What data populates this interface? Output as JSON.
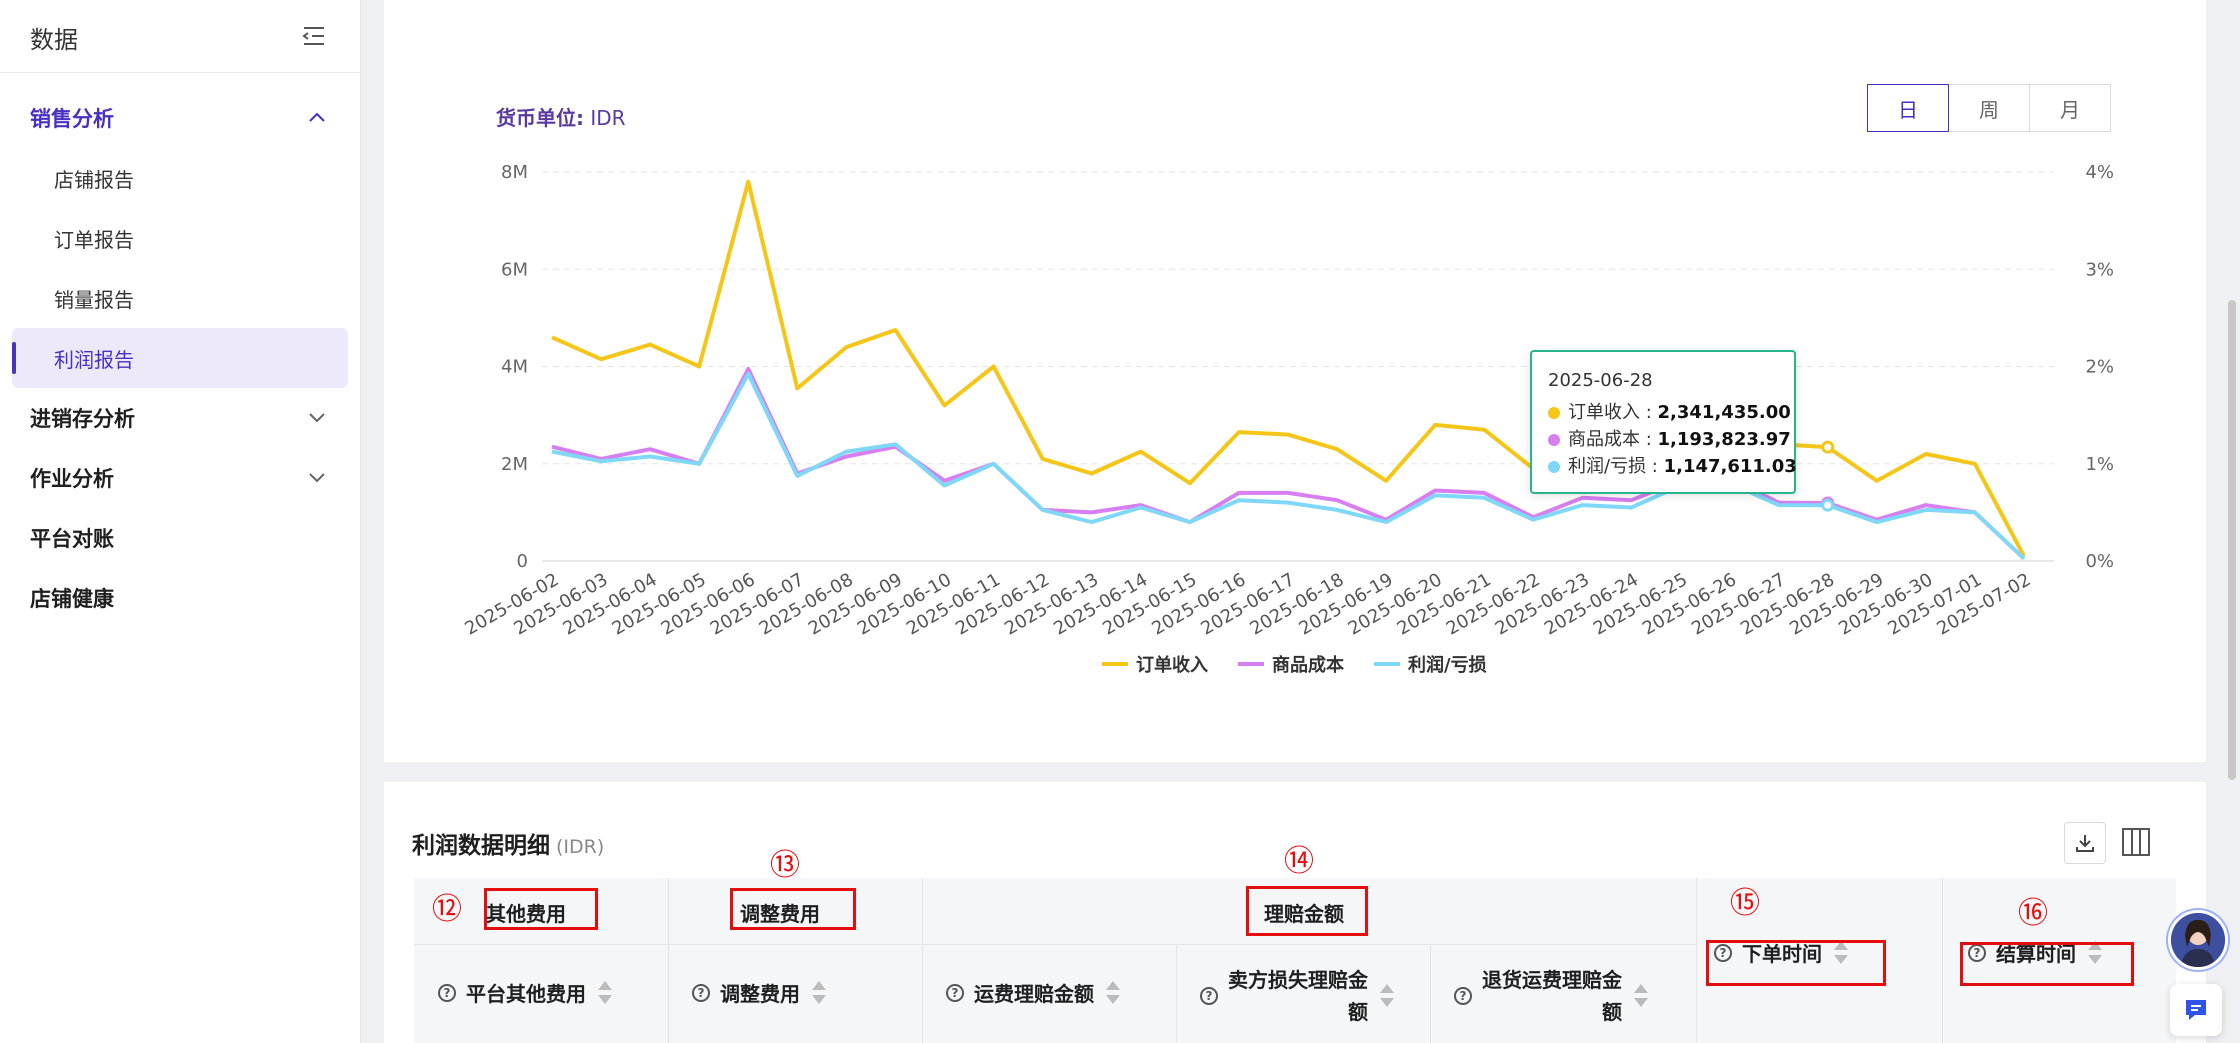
{
  "sidebar": {
    "title": "数据",
    "groups": [
      {
        "label": "销售分析",
        "expanded": true,
        "items": [
          "店铺报告",
          "订单报告",
          "销量报告",
          "利润报告"
        ],
        "selected": "利润报告"
      },
      {
        "label": "进销存分析",
        "expanded": false
      },
      {
        "label": "作业分析",
        "expanded": false
      },
      {
        "label": "平台对账"
      },
      {
        "label": "店铺健康"
      }
    ]
  },
  "chart_header": {
    "currency_label": "货币单位:",
    "currency_value": "IDR",
    "period_tabs": [
      "日",
      "周",
      "月"
    ],
    "active_tab": "日"
  },
  "chart_data": {
    "type": "line",
    "x": [
      "2025-06-02",
      "2025-06-03",
      "2025-06-04",
      "2025-06-05",
      "2025-06-06",
      "2025-06-07",
      "2025-06-08",
      "2025-06-09",
      "2025-06-10",
      "2025-06-11",
      "2025-06-12",
      "2025-06-13",
      "2025-06-14",
      "2025-06-15",
      "2025-06-16",
      "2025-06-17",
      "2025-06-18",
      "2025-06-19",
      "2025-06-20",
      "2025-06-21",
      "2025-06-22",
      "2025-06-23",
      "2025-06-24",
      "2025-06-25",
      "2025-06-26",
      "2025-06-27",
      "2025-06-28",
      "2025-06-29",
      "2025-06-30",
      "2025-07-01",
      "2025-07-02"
    ],
    "y_left_ticks": [
      "0",
      "2M",
      "4M",
      "6M",
      "8M"
    ],
    "y_left_range": [
      0,
      8000000
    ],
    "y_right_ticks": [
      "0%",
      "1%",
      "2%",
      "3%",
      "4%"
    ],
    "grid": true,
    "legend_position": "bottom-center",
    "series": [
      {
        "name": "订单收入",
        "color": "#f5c518",
        "values": [
          4600000,
          4150000,
          4450000,
          4000000,
          7800000,
          3550000,
          4400000,
          4750000,
          3200000,
          4000000,
          2100000,
          1800000,
          2250000,
          1600000,
          2650000,
          2600000,
          2300000,
          1650000,
          2800000,
          2700000,
          1900000,
          2300000,
          2150000,
          2700000,
          2750000,
          2400000,
          2341435,
          1650000,
          2200000,
          2000000,
          100000
        ]
      },
      {
        "name": "商品成本",
        "color": "#d77ff0",
        "values": [
          2350000,
          2100000,
          2300000,
          2000000,
          3950000,
          1800000,
          2150000,
          2350000,
          1650000,
          2000000,
          1050000,
          1000000,
          1150000,
          800000,
          1400000,
          1400000,
          1250000,
          850000,
          1450000,
          1400000,
          900000,
          1300000,
          1250000,
          1650000,
          1700000,
          1200000,
          1193823.97,
          850000,
          1150000,
          1000000,
          50000
        ]
      },
      {
        "name": "利润/亏损",
        "color": "#7fd8f7",
        "values": [
          2250000,
          2050000,
          2150000,
          2000000,
          3850000,
          1750000,
          2250000,
          2400000,
          1550000,
          2000000,
          1050000,
          800000,
          1100000,
          800000,
          1250000,
          1200000,
          1050000,
          800000,
          1350000,
          1300000,
          850000,
          1150000,
          1100000,
          1550000,
          1600000,
          1150000,
          1147611.03,
          800000,
          1050000,
          1000000,
          50000
        ]
      }
    ]
  },
  "tooltip": {
    "date": "2025-06-28",
    "rows": [
      {
        "label": "订单收入 : ",
        "value": "2,341,435.00",
        "color": "#f5c518"
      },
      {
        "label": "商品成本 : ",
        "value": "1,193,823.97",
        "color": "#d77ff0"
      },
      {
        "label": "利润/亏损 : ",
        "value": "1,147,611.03",
        "color": "#7fd8f7"
      }
    ]
  },
  "table": {
    "title": "利润数据明细",
    "unit": "(IDR)",
    "group_headers": [
      "其他费用",
      "调整费用",
      "理赔金额"
    ],
    "columns": [
      "平台其他费用",
      "调整费用",
      "运费理赔金额",
      "卖方损失理赔金额",
      "退货运费理赔金额",
      "下单时间",
      "结算时间"
    ],
    "annotations": [
      "⑫",
      "⑬",
      "⑭",
      "⑮",
      "⑯"
    ]
  }
}
